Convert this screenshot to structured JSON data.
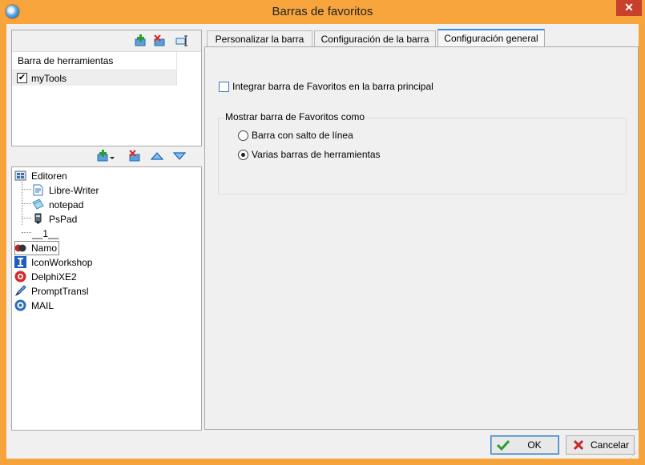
{
  "window": {
    "title": "Barras de favoritos",
    "close_glyph": "✕"
  },
  "left_top": {
    "column_header": "Barra de herramientas",
    "rows": [
      {
        "label": "myTools",
        "checked": true
      }
    ],
    "toolbar_icons": [
      "add-bar-icon",
      "delete-bar-icon",
      "rename-bar-icon"
    ]
  },
  "left_bottom": {
    "toolbar_icons": [
      "add-item-icon",
      "dropdown-arrow-icon",
      "delete-item-icon",
      "move-up-icon",
      "move-down-icon"
    ],
    "tree": [
      {
        "label": "Editoren",
        "icon": "folder-icon"
      },
      {
        "label": "Libre-Writer",
        "icon": "writer-document-icon"
      },
      {
        "label": "notepad",
        "icon": "notepad-icon"
      },
      {
        "label": "PsPad",
        "icon": "pspad-icon"
      },
      {
        "label": "__1__",
        "icon": ""
      },
      {
        "label": "Namo",
        "icon": "namo-icon"
      },
      {
        "label": "IconWorkshop",
        "icon": "iconworkshop-icon"
      },
      {
        "label": "DelphiXE2",
        "icon": "delphi-icon"
      },
      {
        "label": "PromptTransl",
        "icon": "pen-icon"
      },
      {
        "label": "MAIL",
        "icon": "mail-icon"
      }
    ]
  },
  "tabs": [
    {
      "label": "Personalizar la barra"
    },
    {
      "label": "Configuración de la barra"
    },
    {
      "label": "Configuración general"
    }
  ],
  "general": {
    "integrate_label": "Integrar barra de Favoritos en la barra principal",
    "integrate_checked": false,
    "group_title": "Mostrar barra de Favoritos como",
    "options": [
      {
        "label": "Barra con salto de línea",
        "selected": false
      },
      {
        "label": "Varias barras de herramientas",
        "selected": true
      }
    ]
  },
  "buttons": {
    "ok": "OK",
    "cancel": "Cancelar"
  },
  "colors": {
    "title_bar": "#f7a53c",
    "accent": "#3b8fd8",
    "close": "#c7402c"
  }
}
